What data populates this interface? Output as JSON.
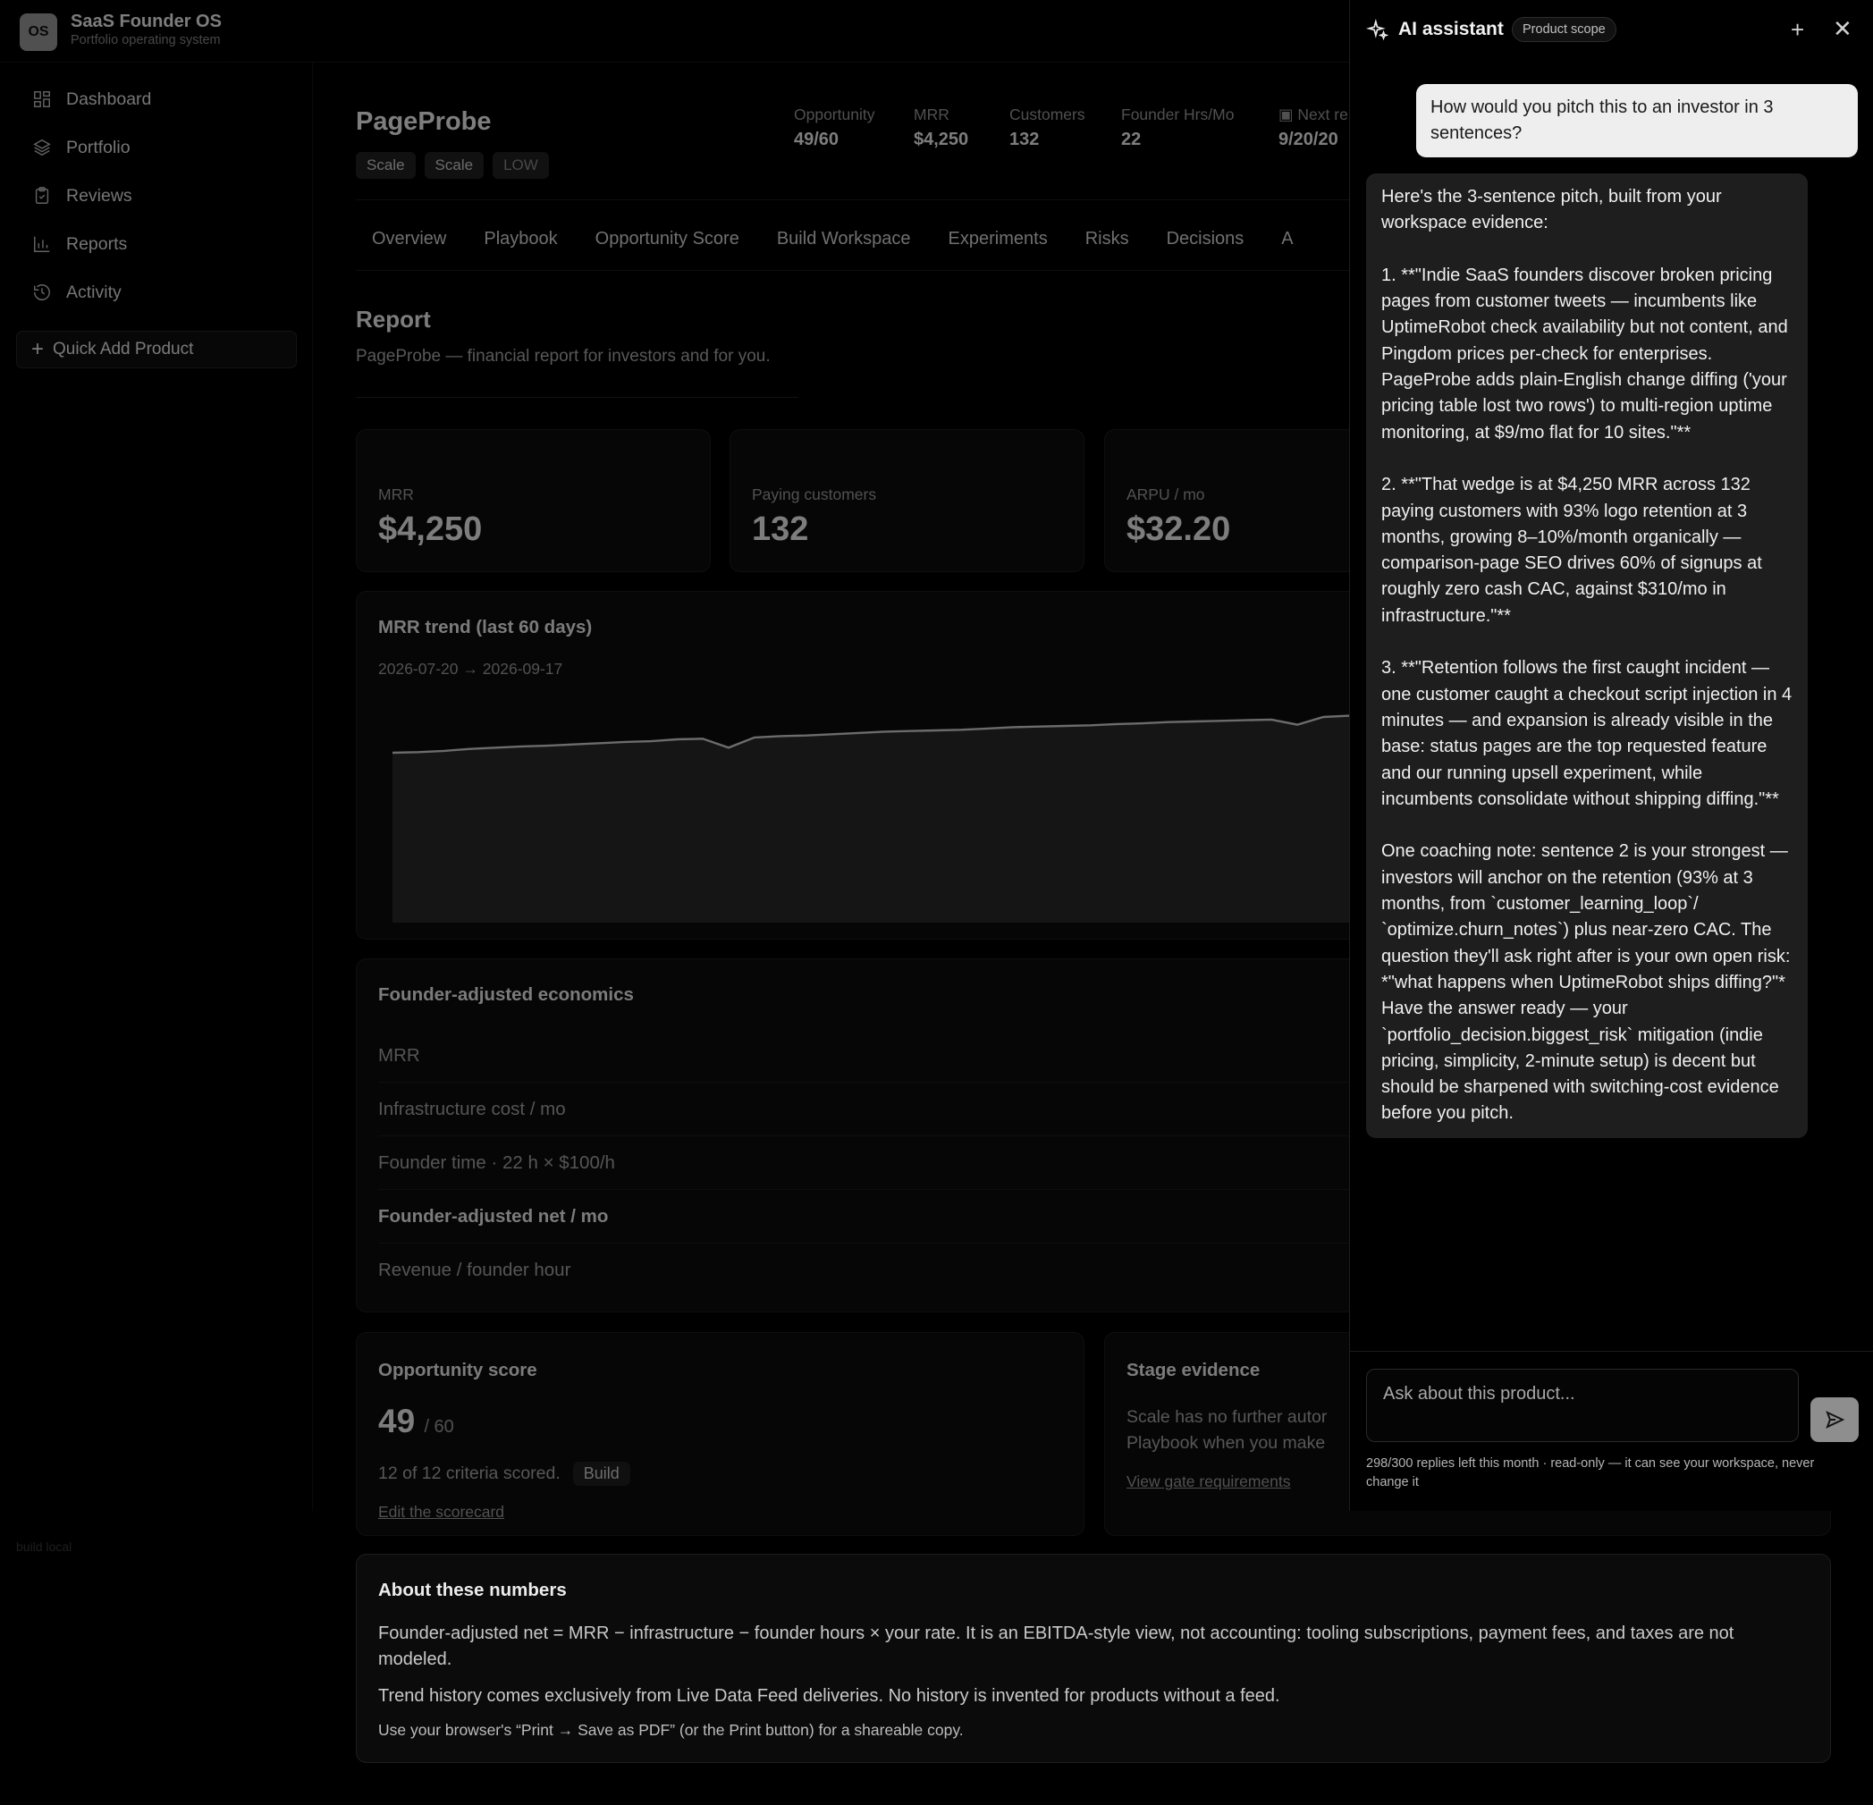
{
  "app": {
    "logo": "OS",
    "name": "SaaS Founder OS",
    "tagline": "Portfolio operating system",
    "build": "build local"
  },
  "sidebar": {
    "items": [
      {
        "label": "Dashboard",
        "icon": "dashboard-icon"
      },
      {
        "label": "Portfolio",
        "icon": "layers-icon"
      },
      {
        "label": "Reviews",
        "icon": "clipboard-check-icon"
      },
      {
        "label": "Reports",
        "icon": "bar-chart-icon"
      },
      {
        "label": "Activity",
        "icon": "history-icon"
      }
    ],
    "quick_add": "Quick Add Product"
  },
  "product": {
    "title": "PageProbe",
    "chips": [
      "Scale",
      "Scale",
      "LOW"
    ],
    "metrics": [
      {
        "label": "Opportunity",
        "value": "49/60"
      },
      {
        "label": "MRR",
        "value": "$4,250"
      },
      {
        "label": "Customers",
        "value": "132"
      },
      {
        "label": "Founder Hrs/Mo",
        "value": "22"
      },
      {
        "label": "Next re",
        "value": "9/20/20"
      }
    ]
  },
  "tabs": [
    "Overview",
    "Playbook",
    "Opportunity Score",
    "Build Workspace",
    "Experiments",
    "Risks",
    "Decisions",
    "A"
  ],
  "report": {
    "title": "Report",
    "subtitle": "PageProbe — financial report for investors and for you.",
    "kpis": [
      {
        "label": "MRR",
        "value": "$4,250"
      },
      {
        "label": "Paying customers",
        "value": "132"
      },
      {
        "label": "ARPU / mo",
        "value": "$32.20"
      }
    ],
    "trend": {
      "title": "MRR trend (last 60 days)",
      "range": "2026-07-20 → 2026-09-17"
    },
    "economics": {
      "title": "Founder-adjusted economics",
      "rows": [
        "MRR",
        "Infrastructure cost / mo",
        "Founder time · 22 h × $100/h",
        "Founder-adjusted net / mo",
        "Revenue / founder hour"
      ]
    },
    "score": {
      "title": "Opportunity score",
      "value": "49",
      "of": "/ 60",
      "note": "12 of 12 criteria scored.",
      "badge": "Build",
      "link": "Edit the scorecard"
    },
    "stage": {
      "title": "Stage evidence",
      "text1": "Scale has no further autor",
      "text2": "Playbook when you make",
      "link": "View gate requirements"
    },
    "about": {
      "title": "About these numbers",
      "p1": "Founder-adjusted net = MRR − infrastructure − founder hours × your rate. It is an EBITDA-style view, not accounting: tooling subscriptions, payment fees, and taxes are not modeled.",
      "p2": "Trend history comes exclusively from Live Data Feed deliveries. No history is invented for products without a feed.",
      "p3": "Use your browser's “Print → Save as PDF” (or the Print button) for a shareable copy."
    }
  },
  "chart_data": {
    "type": "area",
    "title": "MRR trend (last 60 days)",
    "x_range": [
      "2026-07-20",
      "2026-09-17"
    ],
    "values": [
      3830,
      3835,
      3845,
      3860,
      3870,
      3880,
      3885,
      3895,
      3905,
      3915,
      3920,
      3935,
      3940,
      3870,
      3950,
      3960,
      3965,
      3975,
      3985,
      3995,
      4000,
      4005,
      4010,
      4020,
      4030,
      4035,
      4040,
      4045,
      4055,
      4060,
      4070,
      4075,
      4080,
      4085,
      4090,
      4050,
      4110,
      4120
    ],
    "note": "series continues beyond visible area (covered by assistant panel)"
  },
  "assistant": {
    "title": "AI assistant",
    "scope": "Product scope",
    "user_message": "How would you pitch this to an investor in 3 sentences?",
    "reply": [
      "Here's the 3-sentence pitch, built from your workspace evidence:",
      "1. **\"Indie SaaS founders discover broken pricing pages from customer tweets — incumbents like UptimeRobot check availability but not content, and Pingdom prices per-check for enterprises. PageProbe adds plain-English change diffing ('your pricing table lost two rows') to multi-region uptime monitoring, at $9/mo flat for 10 sites.\"**",
      "2. **\"That wedge is at $4,250 MRR across 132 paying customers with 93% logo retention at 3 months, growing 8–10%/month organically — comparison-page SEO drives 60% of signups at roughly zero cash CAC, against $310/mo in infrastructure.\"**",
      "3. **\"Retention follows the first caught incident — one customer caught a checkout script injection in 4 minutes — and expansion is already visible in the base: status pages are the top requested feature and our running upsell experiment, while incumbents consolidate without shipping diffing.\"**",
      "One coaching note: sentence 2 is your strongest — investors will anchor on the retention (93% at 3 months, from `customer_learning_loop`/ `optimize.churn_notes`) plus near-zero CAC. The question they'll ask right after is your own open risk: *\"what happens when UptimeRobot ships diffing?\"* Have the answer ready — your `portfolio_decision.biggest_risk` mitigation (indie pricing, simplicity, 2-minute setup) is decent but should be sharpened with switching-cost evidence before you pitch."
    ],
    "input_placeholder": "Ask about this product...",
    "footer": "298/300 replies left this month · read-only — it can see your workspace, never change it"
  }
}
